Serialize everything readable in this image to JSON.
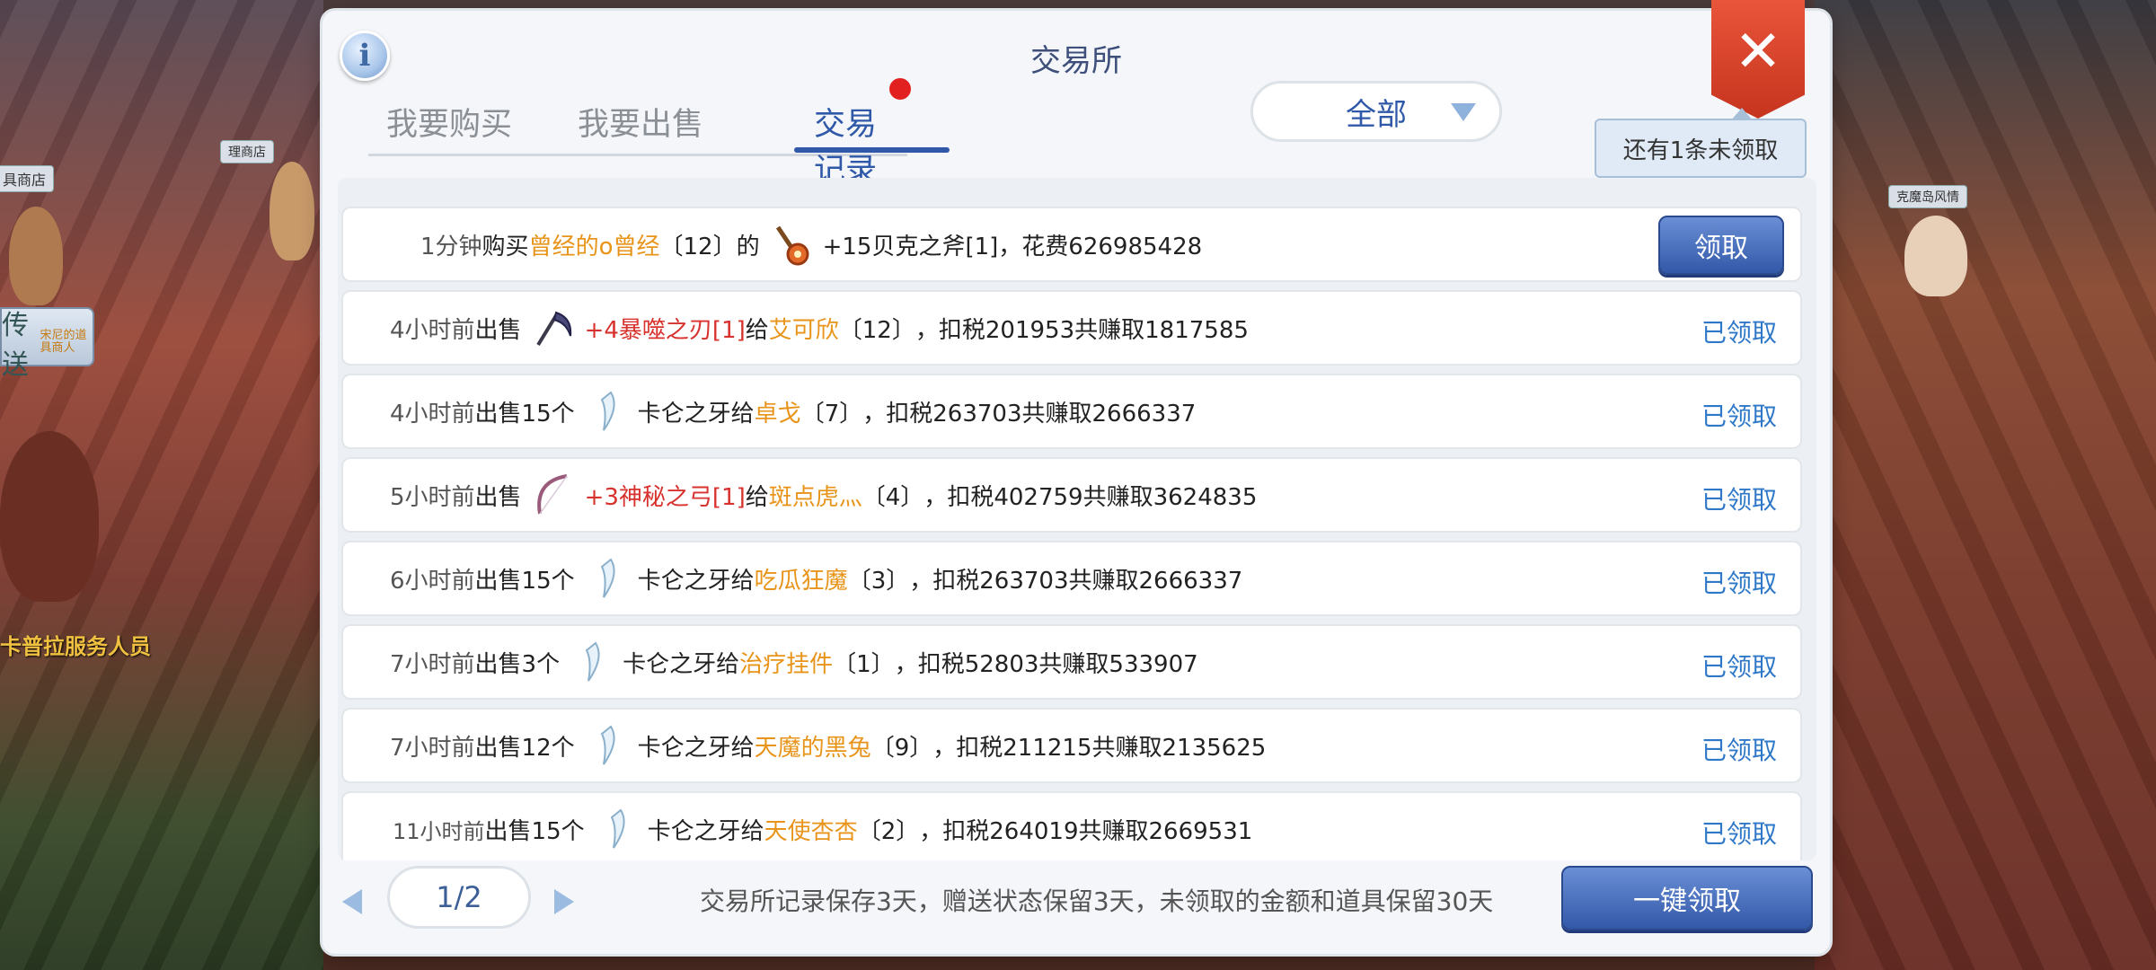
{
  "scene": {
    "npc_labels": [
      "具商店",
      "理商店",
      "克魔岛风情"
    ],
    "npc_service": "卡普拉服务人员",
    "teleport": {
      "label": "传送",
      "sub": "宋尼的道具商人"
    }
  },
  "panel": {
    "title": "交易所",
    "info_icon": "info-icon",
    "close_icon": "close-icon"
  },
  "tabs": [
    {
      "label": "我要购买",
      "active": false
    },
    {
      "label": "我要出售",
      "active": false
    },
    {
      "label": "交易记录",
      "active": true
    }
  ],
  "filter": {
    "selected": "全部"
  },
  "tooltip": "还有1条未领取",
  "records": [
    {
      "time": "1分钟",
      "action": "购买",
      "player": "曾经的o曾经",
      "level": "〔12〕的",
      "icon": "axe-icon",
      "item": "+15贝克之斧[1]",
      "suffix": "，花费626985428",
      "status": "领取",
      "pending": true
    },
    {
      "time": "4小时前",
      "action": "出售",
      "icon": "scythe-icon",
      "item": "+4暴噬之刃[1]",
      "give": "给",
      "player": "艾可欣",
      "level": "〔12〕",
      "suffix": "，扣税201953共赚取1817585",
      "status": "已领取"
    },
    {
      "time": "4小时前",
      "action": "出售15个",
      "icon": "fang-icon",
      "item": "卡仑之牙",
      "give": "给",
      "player": "卓戈",
      "level": "〔7〕",
      "suffix": "，扣税263703共赚取2666337",
      "status": "已领取"
    },
    {
      "time": "5小时前",
      "action": "出售",
      "icon": "bow-icon",
      "item": "+3神秘之弓[1]",
      "give": "给",
      "player": "斑点虎灬",
      "level": "〔4〕",
      "suffix": "，扣税402759共赚取3624835",
      "status": "已领取"
    },
    {
      "time": "6小时前",
      "action": "出售15个",
      "icon": "fang-icon",
      "item": "卡仑之牙",
      "give": "给",
      "player": "吃瓜狂魔",
      "level": "〔3〕",
      "suffix": "，扣税263703共赚取2666337",
      "status": "已领取"
    },
    {
      "time": "7小时前",
      "action": "出售3个",
      "icon": "fang-icon",
      "item": "卡仑之牙",
      "give": "给",
      "player": "治疗挂件",
      "level": "〔1〕",
      "suffix": "，扣税52803共赚取533907",
      "status": "已领取"
    },
    {
      "time": "7小时前",
      "action": "出售12个",
      "icon": "fang-icon",
      "item": "卡仑之牙",
      "give": "给",
      "player": "天魔的黑兔",
      "level": "〔9〕",
      "suffix": "，扣税211215共赚取2135625",
      "status": "已领取"
    },
    {
      "time": "11小时前",
      "action": "出售15个",
      "icon": "fang-icon",
      "item": "卡仑之牙",
      "give": "给",
      "player": "天使杏杏",
      "level": "〔2〕",
      "suffix": "，扣税264019共赚取2669531",
      "status": "已领取"
    }
  ],
  "footer": {
    "page": "1/2",
    "note": "交易所记录保存3天，赠送状态保留3天，未领取的金额和道具保留30天",
    "claim_all": "一键领取"
  },
  "colors": {
    "accent": "#2f58a8",
    "player": "#e8941a",
    "item_red": "#d8322e",
    "claimed": "#2f78c8",
    "close": "#d9422a"
  }
}
